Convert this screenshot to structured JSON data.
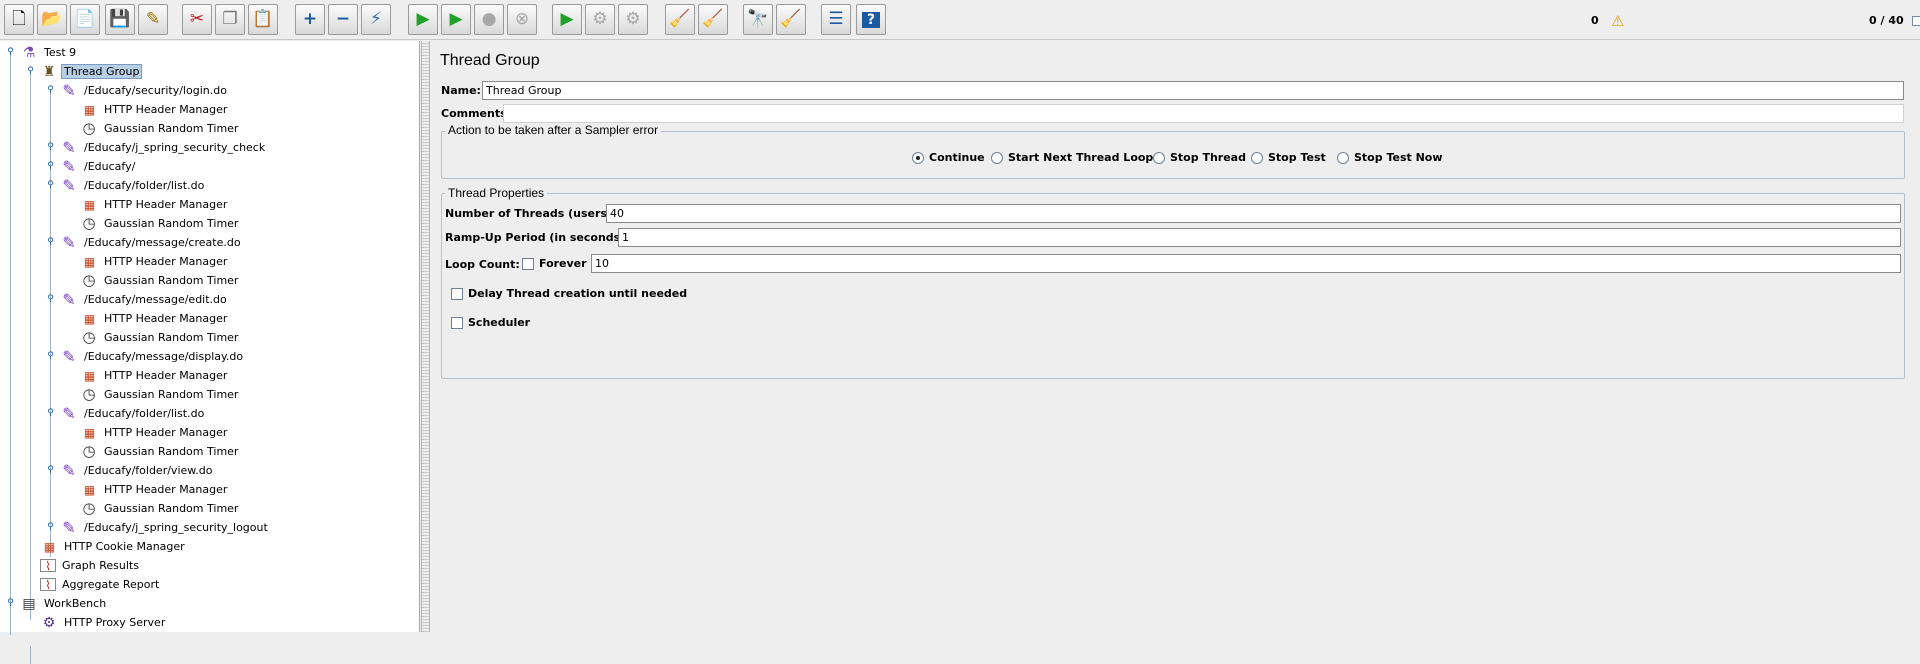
{
  "toolbar": {
    "buttons": [
      {
        "name": "new-button",
        "glyph": "🗋"
      },
      {
        "name": "templates-button",
        "glyph": "📂"
      },
      {
        "name": "open-button",
        "glyph": "📄"
      },
      {
        "name": "save-button",
        "glyph": "💾"
      },
      {
        "name": "save-as-button",
        "glyph": "✎"
      },
      {
        "name": "cut-button",
        "glyph": "✂"
      },
      {
        "name": "copy-button",
        "glyph": "❐"
      },
      {
        "name": "paste-button",
        "glyph": "📋"
      },
      {
        "name": "expand-all-button",
        "glyph": "+"
      },
      {
        "name": "collapse-all-button",
        "glyph": "−"
      },
      {
        "name": "toggle-button",
        "glyph": "⚡"
      },
      {
        "name": "start-button",
        "glyph": "▶"
      },
      {
        "name": "start-no-timers-button",
        "glyph": "▶"
      },
      {
        "name": "stop-button",
        "glyph": "●"
      },
      {
        "name": "shutdown-button",
        "glyph": "⊗"
      },
      {
        "name": "remote-start-all-button",
        "glyph": "▶"
      },
      {
        "name": "remote-stop-all-button",
        "glyph": "⚙"
      },
      {
        "name": "remote-shutdown-all-button",
        "glyph": "⚙"
      },
      {
        "name": "clear-button",
        "glyph": "🧹"
      },
      {
        "name": "clear-all-button",
        "glyph": "🧹"
      },
      {
        "name": "search-button",
        "glyph": "🔭"
      },
      {
        "name": "reset-search-button",
        "glyph": "🧹"
      },
      {
        "name": "function-helper-button",
        "glyph": "☰"
      },
      {
        "name": "help-button",
        "glyph": "?"
      }
    ],
    "error_count": "0",
    "thread_count": "0 / 40"
  },
  "tree": {
    "items": [
      {
        "label": "Test 9",
        "icon": "test-plan-icon",
        "glyph": "⚗"
      },
      {
        "label": "Thread Group",
        "icon": "thread-group-icon",
        "glyph": "♜"
      },
      {
        "label": "/Educafy/security/login.do",
        "icon": "http-sampler-icon",
        "glyph": "✎"
      },
      {
        "label": "HTTP Header Manager",
        "icon": "header-manager-icon",
        "glyph": "▦"
      },
      {
        "label": "Gaussian Random Timer",
        "icon": "timer-icon",
        "glyph": "◷"
      },
      {
        "label": "/Educafy/j_spring_security_check",
        "icon": "http-sampler-icon",
        "glyph": "✎"
      },
      {
        "label": "/Educafy/",
        "icon": "http-sampler-icon",
        "glyph": "✎"
      },
      {
        "label": "/Educafy/folder/list.do",
        "icon": "http-sampler-icon",
        "glyph": "✎"
      },
      {
        "label": "HTTP Header Manager",
        "icon": "header-manager-icon",
        "glyph": "▦"
      },
      {
        "label": "Gaussian Random Timer",
        "icon": "timer-icon",
        "glyph": "◷"
      },
      {
        "label": "/Educafy/message/create.do",
        "icon": "http-sampler-icon",
        "glyph": "✎"
      },
      {
        "label": "HTTP Header Manager",
        "icon": "header-manager-icon",
        "glyph": "▦"
      },
      {
        "label": "Gaussian Random Timer",
        "icon": "timer-icon",
        "glyph": "◷"
      },
      {
        "label": "/Educafy/message/edit.do",
        "icon": "http-sampler-icon",
        "glyph": "✎"
      },
      {
        "label": "HTTP Header Manager",
        "icon": "header-manager-icon",
        "glyph": "▦"
      },
      {
        "label": "Gaussian Random Timer",
        "icon": "timer-icon",
        "glyph": "◷"
      },
      {
        "label": "/Educafy/message/display.do",
        "icon": "http-sampler-icon",
        "glyph": "✎"
      },
      {
        "label": "HTTP Header Manager",
        "icon": "header-manager-icon",
        "glyph": "▦"
      },
      {
        "label": "Gaussian Random Timer",
        "icon": "timer-icon",
        "glyph": "◷"
      },
      {
        "label": "/Educafy/folder/list.do",
        "icon": "http-sampler-icon",
        "glyph": "✎"
      },
      {
        "label": "HTTP Header Manager",
        "icon": "header-manager-icon",
        "glyph": "▦"
      },
      {
        "label": "Gaussian Random Timer",
        "icon": "timer-icon",
        "glyph": "◷"
      },
      {
        "label": "/Educafy/folder/view.do",
        "icon": "http-sampler-icon",
        "glyph": "✎"
      },
      {
        "label": "HTTP Header Manager",
        "icon": "header-manager-icon",
        "glyph": "▦"
      },
      {
        "label": "Gaussian Random Timer",
        "icon": "timer-icon",
        "glyph": "◷"
      },
      {
        "label": "/Educafy/j_spring_security_logout",
        "icon": "http-sampler-icon",
        "glyph": "✎"
      },
      {
        "label": "HTTP Cookie Manager",
        "icon": "cookie-manager-icon",
        "glyph": "▦"
      },
      {
        "label": "Graph Results",
        "icon": "graph-results-icon",
        "glyph": "⌇"
      },
      {
        "label": "Aggregate Report",
        "icon": "aggregate-report-icon",
        "glyph": "⌇"
      },
      {
        "label": "WorkBench",
        "icon": "workbench-icon",
        "glyph": "▤"
      },
      {
        "label": "HTTP Proxy Server",
        "icon": "proxy-server-icon",
        "glyph": "⚙"
      }
    ]
  },
  "main": {
    "title": "Thread Group",
    "name_label": "Name:",
    "name_value": "Thread Group",
    "comments_label": "Comments:",
    "sampler_error": {
      "legend": "Action to be taken after a Sampler error",
      "options": [
        "Continue",
        "Start Next Thread Loop",
        "Stop Thread",
        "Stop Test",
        "Stop Test Now"
      ],
      "selected": "Continue"
    },
    "thread_props": {
      "legend": "Thread Properties",
      "threads_label": "Number of Threads (users):",
      "threads_value": "40",
      "rampup_label": "Ramp-Up Period (in seconds):",
      "rampup_value": "1",
      "loop_label": "Loop Count:",
      "forever_label": "Forever",
      "loop_value": "10",
      "delay_label": "Delay Thread creation until needed",
      "scheduler_label": "Scheduler"
    }
  }
}
